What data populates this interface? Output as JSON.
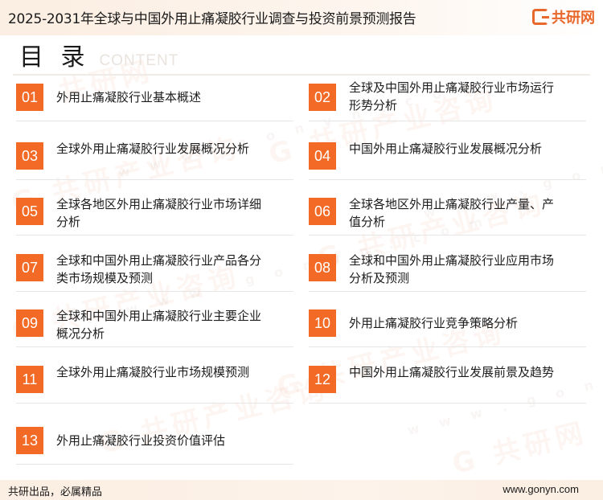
{
  "header": {
    "title": "2025-2031年全球与中国外用止痛凝胶行业调查与投资前景预测报告",
    "brand": "共研网"
  },
  "toc": {
    "title": "目 录",
    "subtitle": "CONTENT",
    "items": [
      {
        "num": "01",
        "label": "外用止痛凝胶行业基本概述"
      },
      {
        "num": "02",
        "label": "全球及中国外用止痛凝胶行业市场运行形势分析"
      },
      {
        "num": "03",
        "label": "全球外用止痛凝胶行业发展概况分析"
      },
      {
        "num": "04",
        "label": "中国外用止痛凝胶行业发展概况分析"
      },
      {
        "num": "05",
        "label": "全球各地区外用止痛凝胶行业市场详细分析"
      },
      {
        "num": "06",
        "label": "全球各地区外用止痛凝胶行业产量、产值分析"
      },
      {
        "num": "07",
        "label": "全球和中国外用止痛凝胶行业产品各分类市场规模及预测"
      },
      {
        "num": "08",
        "label": "全球和中国外用止痛凝胶行业应用市场分析及预测"
      },
      {
        "num": "09",
        "label": "全球和中国外用止痛凝胶行业主要企业概况分析"
      },
      {
        "num": "10",
        "label": "外用止痛凝胶行业竞争策略分析"
      },
      {
        "num": "11",
        "label": "全球外用止痛凝胶行业市场规模预测"
      },
      {
        "num": "12",
        "label": "中国外用止痛凝胶行业发展前景及趋势"
      },
      {
        "num": "13",
        "label": "外用止痛凝胶行业投资价值评估"
      }
    ]
  },
  "footer": {
    "slogan": "共研出品，必属精品",
    "website": "www.gonyn.com"
  },
  "colors": {
    "accent": "#f26a25",
    "header_bg": "#fbeee2"
  }
}
